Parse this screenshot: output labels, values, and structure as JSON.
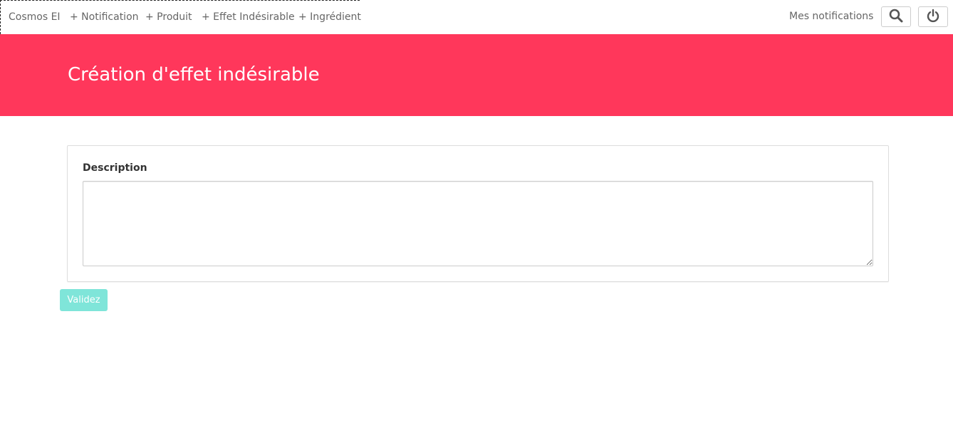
{
  "navbar": {
    "brand": "Cosmos EI",
    "links": [
      {
        "label": "+ Notification"
      },
      {
        "label": "+ Produit"
      },
      {
        "label": "+ Effet Indésirable"
      },
      {
        "label": "+ Ingrédient"
      }
    ],
    "my_notifications": "Mes notifications",
    "icons": {
      "search": "search-icon",
      "power": "power-icon"
    }
  },
  "hero": {
    "title": "Création d'effet indésirable",
    "background_color": "#ff375b"
  },
  "form": {
    "description_label": "Description",
    "description_value": "",
    "submit_label": "Validez",
    "submit_color": "#7fe5d9"
  }
}
